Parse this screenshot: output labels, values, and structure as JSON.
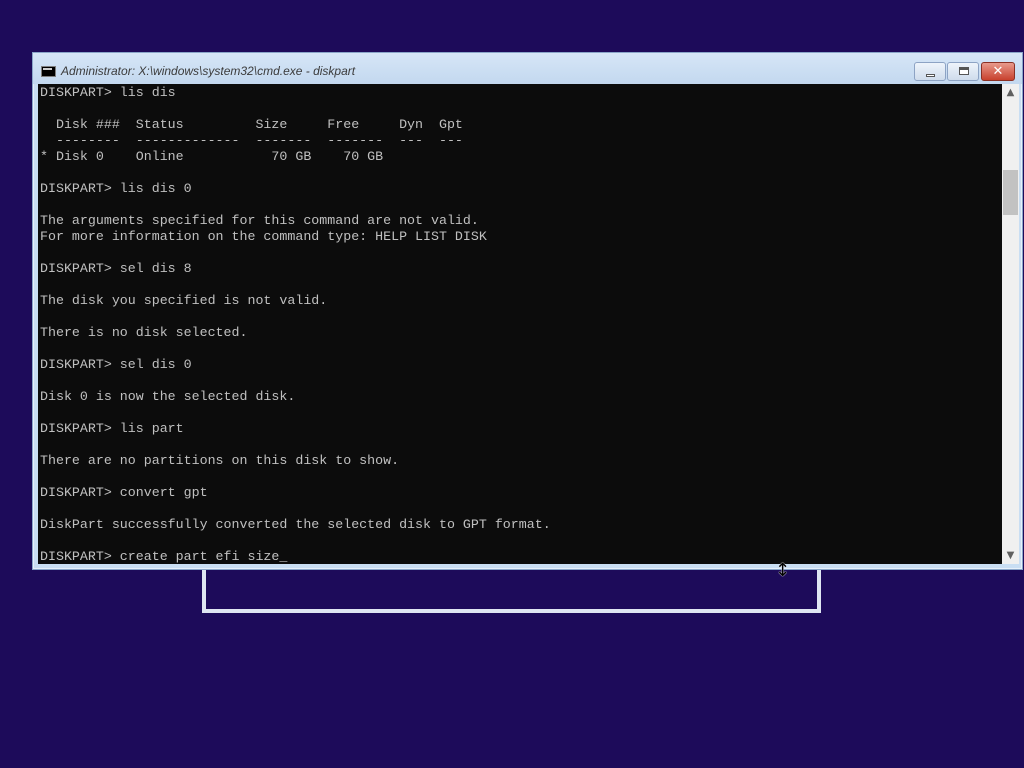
{
  "window": {
    "title": "Administrator: X:\\windows\\system32\\cmd.exe - diskpart",
    "buttons": {
      "minimize": "minimize",
      "maximize": "restore",
      "close": "close"
    }
  },
  "console": {
    "lines": [
      "DISKPART> lis dis",
      "",
      "  Disk ###  Status         Size     Free     Dyn  Gpt",
      "  --------  -------------  -------  -------  ---  ---",
      "* Disk 0    Online           70 GB    70 GB",
      "",
      "DISKPART> lis dis 0",
      "",
      "The arguments specified for this command are not valid.",
      "For more information on the command type: HELP LIST DISK",
      "",
      "DISKPART> sel dis 8",
      "",
      "The disk you specified is not valid.",
      "",
      "There is no disk selected.",
      "",
      "DISKPART> sel dis 0",
      "",
      "Disk 0 is now the selected disk.",
      "",
      "DISKPART> lis part",
      "",
      "There are no partitions on this disk to show.",
      "",
      "DISKPART> convert gpt",
      "",
      "DiskPart successfully converted the selected disk to GPT format.",
      "",
      "DISKPART> create part efi size"
    ],
    "cursor": "_"
  },
  "colors": {
    "desktop": "#1d0b5a",
    "console_bg": "#0c0c0c",
    "console_fg": "#c0c0c0",
    "titlebar": "#c9def3",
    "close_button": "#c8412e"
  },
  "icons": {
    "app": "cmd-icon",
    "scroll_up": "▲",
    "scroll_down": "▼",
    "resize_cursor": "↕"
  }
}
